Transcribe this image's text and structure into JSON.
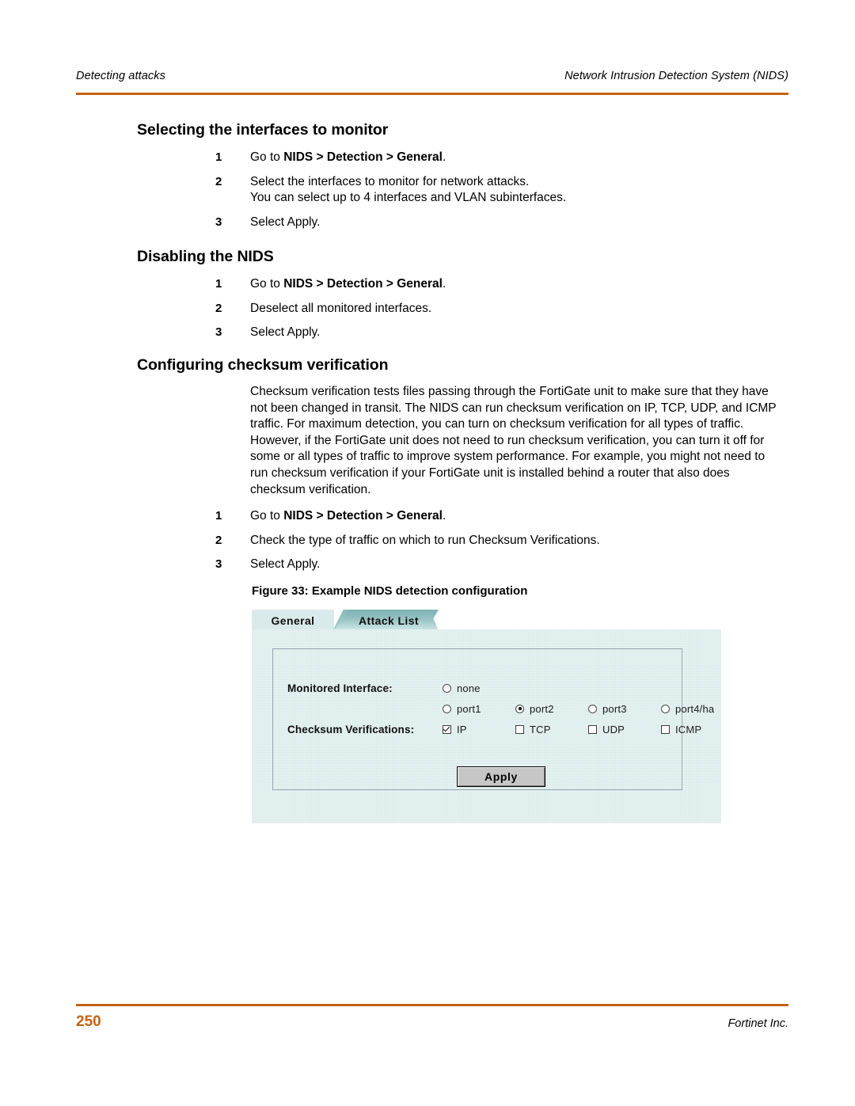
{
  "header": {
    "left": "Detecting attacks",
    "right": "Network Intrusion Detection System (NIDS)",
    "rule_color": "#C4620F"
  },
  "sections": [
    {
      "heading": "Selecting the interfaces to monitor",
      "steps": [
        {
          "num": "1",
          "pre": "Go to ",
          "bold": "NIDS > Detection > General",
          "post": ".",
          "extra": ""
        },
        {
          "num": "2",
          "pre": "Select the interfaces to monitor for network attacks.",
          "bold": "",
          "post": "",
          "extra": "You can select up to 4 interfaces and VLAN subinterfaces."
        },
        {
          "num": "3",
          "pre": "Select Apply.",
          "bold": "",
          "post": "",
          "extra": ""
        }
      ]
    },
    {
      "heading": "Disabling the NIDS",
      "steps": [
        {
          "num": "1",
          "pre": "Go to ",
          "bold": "NIDS > Detection > General",
          "post": ".",
          "extra": ""
        },
        {
          "num": "2",
          "pre": "Deselect all monitored interfaces.",
          "bold": "",
          "post": "",
          "extra": ""
        },
        {
          "num": "3",
          "pre": "Select Apply.",
          "bold": "",
          "post": "",
          "extra": ""
        }
      ]
    },
    {
      "heading": "Configuring checksum verification",
      "paragraph": "Checksum verification tests files passing through the FortiGate unit to make sure that they have not been changed in transit. The NIDS can run checksum verification on IP, TCP, UDP, and ICMP traffic. For maximum detection, you can turn on checksum verification for all types of traffic. However, if the FortiGate unit does not need to run checksum verification, you can turn it off for some or all types of traffic to improve system performance. For example, you might not need to run checksum verification if your FortiGate unit is installed behind a router that also does checksum verification.",
      "steps": [
        {
          "num": "1",
          "pre": "Go to ",
          "bold": "NIDS > Detection > General",
          "post": ".",
          "extra": ""
        },
        {
          "num": "2",
          "pre": "Check the type of traffic on which to run Checksum Verifications.",
          "bold": "",
          "post": "",
          "extra": ""
        },
        {
          "num": "3",
          "pre": "Select Apply.",
          "bold": "",
          "post": "",
          "extra": ""
        }
      ]
    }
  ],
  "figure": {
    "caption": "Figure 33: Example NIDS detection configuration",
    "tabs": [
      {
        "label": "General",
        "active": true
      },
      {
        "label": "Attack List",
        "active": false
      }
    ],
    "fields": {
      "monitored_interface_label": "Monitored Interface:",
      "checksum_label": "Checksum Verifications:",
      "interfaces_row1": [
        {
          "label": "none",
          "selected": false
        }
      ],
      "interfaces_row2": [
        {
          "label": "port1",
          "selected": false
        },
        {
          "label": "port2",
          "selected": true
        },
        {
          "label": "port3",
          "selected": false
        },
        {
          "label": "port4/ha",
          "selected": false
        }
      ],
      "checksums": [
        {
          "label": "IP",
          "checked": true
        },
        {
          "label": "TCP",
          "checked": false
        },
        {
          "label": "UDP",
          "checked": false
        },
        {
          "label": "ICMP",
          "checked": false
        }
      ]
    },
    "apply_label": "Apply",
    "panel_color": "#D6E8E8",
    "tab_active_color": "#D9EAEA",
    "tab_inactive_color": "#8FBEBE"
  },
  "footer": {
    "page_number": "250",
    "publisher": "Fortinet Inc.",
    "rule_color": "#C4620F"
  }
}
